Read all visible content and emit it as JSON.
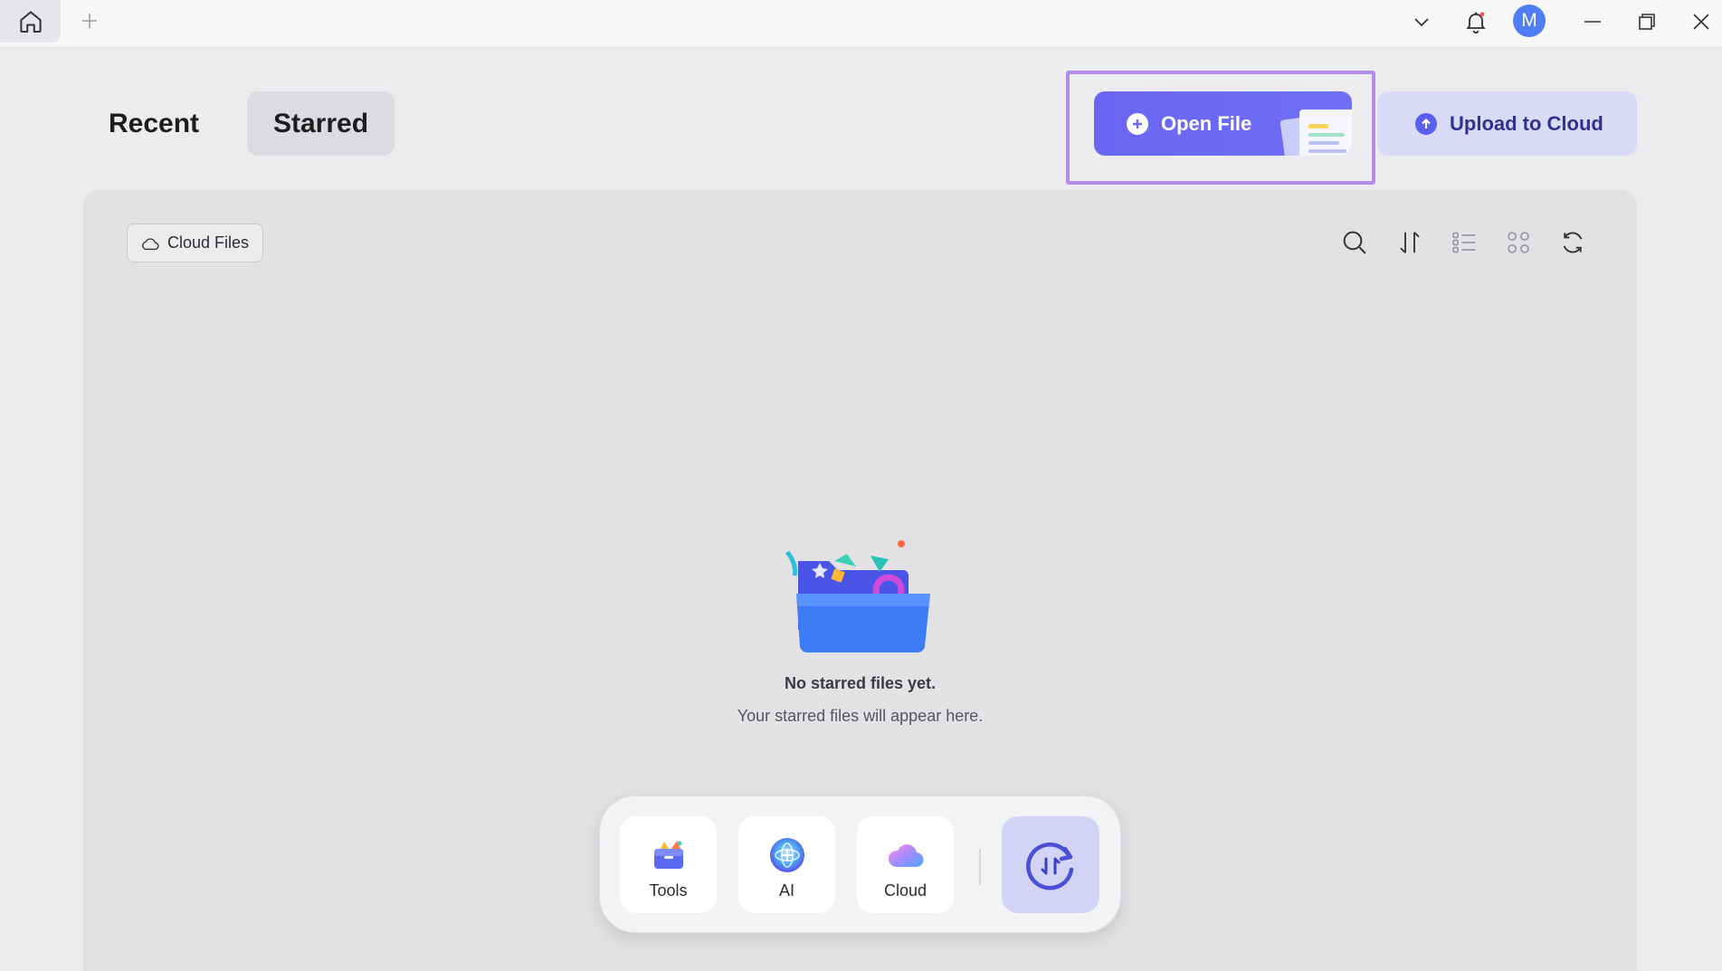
{
  "tabs": {
    "recent": "Recent",
    "starred": "Starred"
  },
  "actions": {
    "open_file": "Open File",
    "upload_to_cloud": "Upload to Cloud"
  },
  "titlebar": {
    "avatar_letter": "M"
  },
  "panel": {
    "cloud_files": "Cloud Files",
    "toolbar_icons": [
      "search-icon",
      "sort-icon",
      "list-view-icon",
      "grid-view-icon",
      "refresh-icon"
    ],
    "empty_title": "No starred files yet.",
    "empty_subtitle": "Your starred files will appear here."
  },
  "dock": {
    "items": [
      "Tools",
      "AI",
      "Cloud"
    ]
  },
  "colors": {
    "accent": "#6a66f3",
    "highlight": "#b48ce8",
    "avatar": "#4f7df5"
  }
}
